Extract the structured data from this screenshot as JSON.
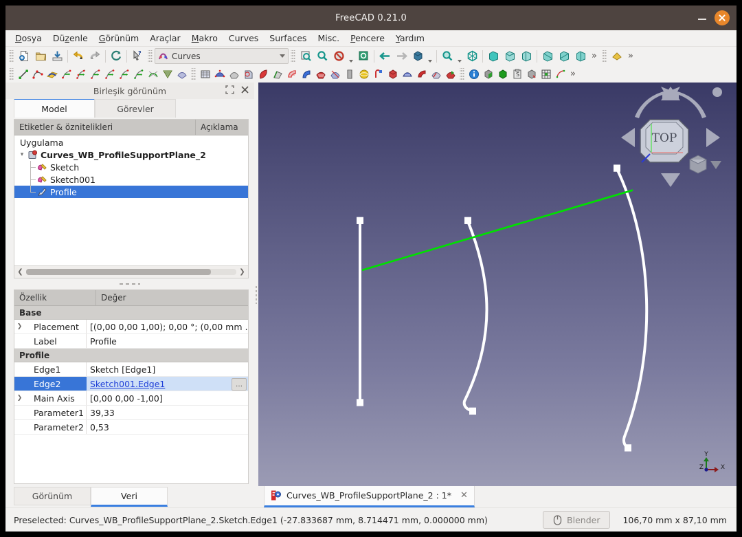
{
  "window": {
    "title": "FreeCAD 0.21.0",
    "minimize_label": "–",
    "close_label": "×"
  },
  "menubar": {
    "items": [
      {
        "label": "Dosya",
        "mnemonic": "D"
      },
      {
        "label": "Düzenle",
        "mnemonic": "z"
      },
      {
        "label": "Görünüm",
        "mnemonic": "G"
      },
      {
        "label": "Araçlar",
        "mnemonic": ""
      },
      {
        "label": "Makro",
        "mnemonic": "M"
      },
      {
        "label": "Curves",
        "mnemonic": ""
      },
      {
        "label": "Surfaces",
        "mnemonic": ""
      },
      {
        "label": "Misc.",
        "mnemonic": ""
      },
      {
        "label": "Pencere",
        "mnemonic": "P"
      },
      {
        "label": "Yardım",
        "mnemonic": "Y"
      }
    ]
  },
  "toolbar": {
    "workbench_selected": "Curves",
    "overflow_label": "»",
    "file_icons": [
      "new-document-icon",
      "open-folder-icon",
      "save-icon"
    ],
    "edit_icons": [
      "undo-icon",
      "redo-icon",
      "refresh-icon",
      "whats-this-icon"
    ],
    "view_icons": [
      "fit-all-icon",
      "fit-selection-icon",
      "draw-style-icon",
      "box-selection-icon"
    ],
    "nav_icons": [
      "back-arrow-icon",
      "forward-arrow-icon",
      "std-view-icon",
      "zoom-icon",
      "axonometric-icon"
    ],
    "std_view_icons": [
      "front-view-icon",
      "top-view-icon",
      "right-view-icon",
      "rear-view-icon",
      "bottom-view-icon",
      "left-view-icon"
    ],
    "measure_icon": "measure-icon"
  },
  "toolbar2": {
    "icons": [
      "line-icon",
      "bspline-icon",
      "editable-spline-icon",
      "interpolate-icon",
      "approximate-icon",
      "discretize-icon",
      "join-curve-icon",
      "split-curve-icon",
      "extend-curve-icon",
      "blend-curve-icon",
      "parametric-comb-icon",
      "zebra-icon",
      "isocurve-icon",
      "profile-support-plane-icon",
      "surface-icon",
      "sweep-icon",
      "gordon-surface-icon",
      "ruled-surface-icon",
      "pipeshell-icon",
      "flatten-icon",
      "segment-surface-icon",
      "trim-face-icon",
      "sketch-on-surface-icon",
      "hooks-icon",
      "sphere-icon",
      "solid-icon",
      "multi-loft-icon",
      "curve-on-mesh-icon",
      "mixed-curve-icon",
      "extract-icon",
      "info-icon",
      "box-element-icon",
      "green-box-icon",
      "clipboard-icon",
      "adjacent-faces-icon",
      "grid-icon",
      "reload-icon"
    ],
    "overflow_label": "»"
  },
  "combo_view": {
    "title": "Birleşik görünüm",
    "float_icon": "float-window-icon",
    "close_icon": "close-icon",
    "tabs": [
      {
        "label": "Model",
        "active": true
      },
      {
        "label": "Görevler",
        "active": false
      }
    ]
  },
  "tree": {
    "columns": [
      "Etiketler & öznitelikleri",
      "Açıklama"
    ],
    "root": "Uygulama",
    "document": "Curves_WB_ProfileSupportPlane_2",
    "items": [
      {
        "label": "Sketch",
        "icon": "sketch-icon",
        "selected": false
      },
      {
        "label": "Sketch001",
        "icon": "sketch-icon",
        "selected": false
      },
      {
        "label": "Profile",
        "icon": "profile-icon",
        "selected": true
      }
    ]
  },
  "properties": {
    "columns": [
      "Özellik",
      "Değer"
    ],
    "groups": [
      {
        "name": "Base",
        "rows": [
          {
            "key": "Placement",
            "value": "[(0,00 0,00 1,00); 0,00 °; (0,00 mm  …",
            "expandable": true,
            "selected": false
          },
          {
            "key": "Label",
            "value": "Profile",
            "expandable": false,
            "selected": false
          }
        ]
      },
      {
        "name": "Profile",
        "rows": [
          {
            "key": "Edge1",
            "value": "Sketch [Edge1]",
            "expandable": false,
            "selected": false
          },
          {
            "key": "Edge2",
            "value": "Sketch001.Edge1",
            "expandable": false,
            "selected": true,
            "link": true,
            "button": "…"
          },
          {
            "key": "Main Axis",
            "value": "[0,00 0,00 -1,00]",
            "expandable": true,
            "selected": false
          },
          {
            "key": "Parameter1",
            "value": "39,33",
            "expandable": false,
            "selected": false
          },
          {
            "key": "Parameter2",
            "value": "0,53",
            "expandable": false,
            "selected": false
          }
        ]
      }
    ]
  },
  "bottom_tabs": [
    {
      "label": "Görünüm",
      "active": false
    },
    {
      "label": "Veri",
      "active": true
    }
  ],
  "document_tab": {
    "label": "Curves_WB_ProfileSupportPlane_2 : 1*",
    "icon": "freecad-document-icon",
    "close_label": "✕"
  },
  "viewport": {
    "navcube_face": "TOP",
    "axis_labels": {
      "x": "X",
      "y": "Y",
      "z": "Z"
    },
    "axis_colors": {
      "x": "#8b1a1a",
      "y": "#1a7a1a",
      "z": "#1a1a8b"
    },
    "curve_color": "#ffffff",
    "selected_edge_color": "#00e000",
    "background_top": "#3a3a66",
    "background_bottom": "#9b9bb4"
  },
  "statusbar": {
    "message": "Preselected: Curves_WB_ProfileSupportPlane_2.Sketch.Edge1 (-27.833687 mm, 8.714471 mm, 0.000000 mm)",
    "nav_style": "Blender",
    "nav_icon": "mouse-icon",
    "dimensions": "106,70 mm x 87,10 mm"
  }
}
